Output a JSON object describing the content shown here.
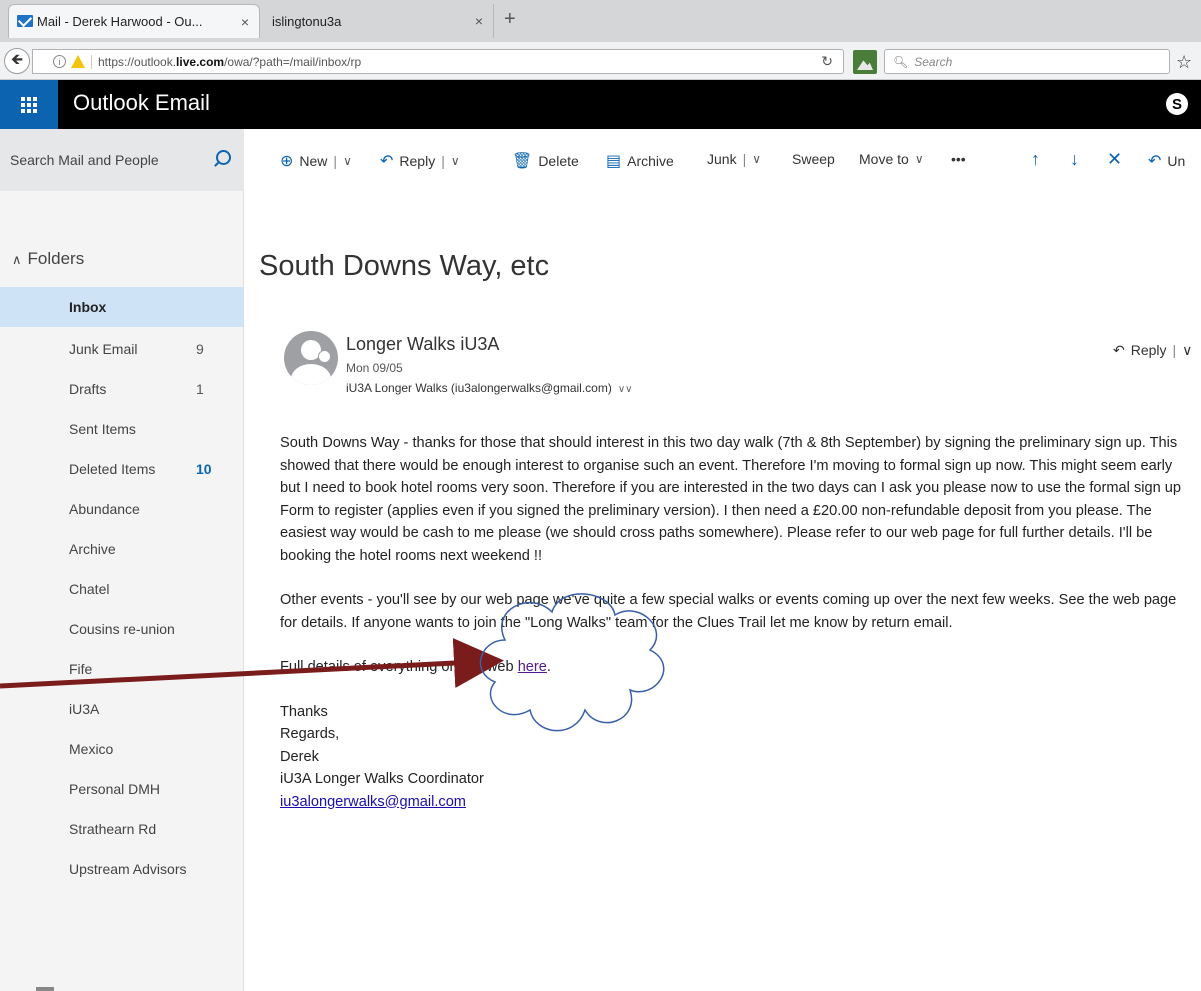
{
  "browser": {
    "tabs": [
      {
        "title": "Mail - Derek Harwood - Ou...",
        "close": "×"
      },
      {
        "title": "islingtonu3a",
        "close": "×"
      }
    ],
    "new_tab": "+",
    "url_host_pre": "https://outlook.",
    "url_host_bold": "live.com",
    "url_path": "/owa/?path=/mail/inbox/rp",
    "search_placeholder": "Search"
  },
  "header": {
    "app_title": "Outlook Email",
    "skype": "S"
  },
  "search": {
    "label": "Search Mail and People"
  },
  "toolbar": {
    "new": "New",
    "reply": "Reply",
    "delete": "Delete",
    "archive": "Archive",
    "junk": "Junk",
    "sweep": "Sweep",
    "move_to": "Move to",
    "more": "•••",
    "undo": "Un"
  },
  "folders": {
    "header": "Folders",
    "items": [
      {
        "name": "Inbox",
        "count": ""
      },
      {
        "name": "Junk Email",
        "count": "9"
      },
      {
        "name": "Drafts",
        "count": "1"
      },
      {
        "name": "Sent Items",
        "count": ""
      },
      {
        "name": "Deleted Items",
        "count": "10"
      },
      {
        "name": "Abundance",
        "count": ""
      },
      {
        "name": "Archive",
        "count": ""
      },
      {
        "name": "Chatel",
        "count": ""
      },
      {
        "name": "Cousins re-union",
        "count": ""
      },
      {
        "name": "Fife",
        "count": ""
      },
      {
        "name": "iU3A",
        "count": ""
      },
      {
        "name": "Mexico",
        "count": ""
      },
      {
        "name": "Personal DMH",
        "count": ""
      },
      {
        "name": "Strathearn Rd",
        "count": ""
      },
      {
        "name": "Upstream Advisors",
        "count": ""
      }
    ]
  },
  "message": {
    "subject": "South Downs Way, etc",
    "sender": "Longer Walks iU3A",
    "date": "Mon 09/05",
    "from_line": "iU3A Longer Walks (iu3alongerwalks@gmail.com)",
    "reply": "Reply",
    "para1": "South Downs Way - thanks for those that should interest in this two day walk (7th & 8th September) by signing the preliminary sign up. This showed that there would be enough interest to organise such an event. Therefore I'm moving to formal sign up now. This might seem early but I need to book hotel rooms very soon. Therefore if you are interested in the two days can I ask you please now to use the formal sign up Form to register (applies even if you signed the preliminary version). I then need a £20.00 non-refundable deposit from you please. The easiest way would be cash to me please (we should cross paths somewhere). Please refer to our web page for full further details. I'll be booking the hotel rooms next weekend !!",
    "para2": "Other events - you'll see by our web page we've quite a few special walks or events coming up over the next few weeks. See the web page for details. If anyone wants to join the \"Long Walks\" team for the Clues Trail let me know by return email.",
    "para3_prefix": "Full details of everything on our web ",
    "para3_link": "here",
    "para3_suffix": ".",
    "signature": {
      "thanks": "Thanks",
      "regards": "Regards,",
      "name": "Derek",
      "role": "iU3A Longer Walks Coordinator",
      "email": "iu3alongerwalks@gmail.com"
    }
  },
  "colors": {
    "brand_blue": "#0c64b0",
    "selected_folder": "#cfe3f7",
    "annotation_arrow": "#7b1c1c"
  }
}
